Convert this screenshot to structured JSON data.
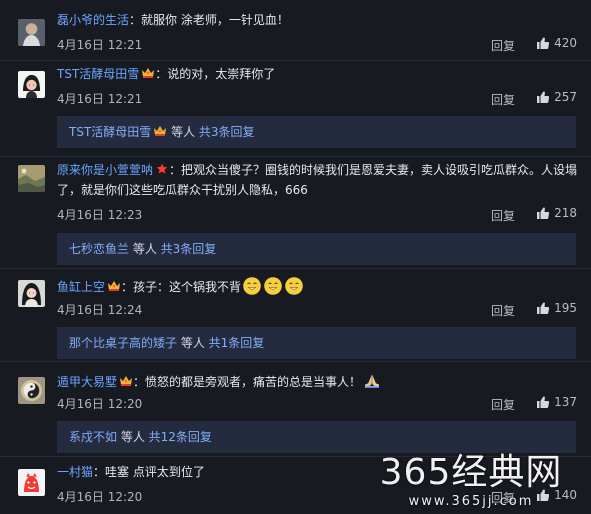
{
  "labels": {
    "reply": "回复"
  },
  "colors": {
    "background": "#171a21",
    "username": "#6aa6ff",
    "reply_bar": "#252b3f"
  },
  "comments": [
    {
      "username": "磊小爷的生活",
      "text": "：就服你 涂老师，一针见血！",
      "date": "4月16日 12:21",
      "likes": "420",
      "badge": ""
    },
    {
      "username": "TST活酵母田雪",
      "text": "：说的对，太崇拜你了",
      "date": "4月16日 12:21",
      "likes": "257",
      "badge": "crown-badge"
    },
    {
      "username": "原来你是小萱萱呐",
      "text": "：把观众当傻子？圈钱的时候我们是恩爱夫妻，卖人设吸引吃瓜群众。人设塌了，就是你们这些吃瓜群众干扰别人隐私，666",
      "date": "4月16日 12:23",
      "likes": "218",
      "badge": "star-badge"
    },
    {
      "username": "鱼缸上空",
      "text": "：孩子：这个锅我不背",
      "date": "4月16日 12:24",
      "likes": "195",
      "badge": "crown-badge"
    },
    {
      "username": "遁甲大易墅",
      "text": "：愤怒的都是旁观者，痛苦的总是当事人！",
      "date": "4月16日 12:20",
      "likes": "137",
      "badge": "crown-badge"
    },
    {
      "username": "一村猫",
      "text": "：哇塞 点评太到位了",
      "date": "4月16日 12:20",
      "likes": "140",
      "badge": ""
    }
  ],
  "reply_bars": [
    {
      "user": "TST活酵母田雪",
      "middle": " 等人 ",
      "total": "共3条回复"
    },
    {
      "user": "七秒恋鱼兰",
      "middle": " 等人 ",
      "total": "共3条回复"
    },
    {
      "user": "那个比桌子高的矮子",
      "middle": " 等人 ",
      "total": "共1条回复"
    },
    {
      "user": "系戍不如",
      "middle": " 等人 ",
      "total": "共12条回复"
    }
  ],
  "watermark": {
    "title": "365经典网",
    "url": "www.365jj.com"
  }
}
